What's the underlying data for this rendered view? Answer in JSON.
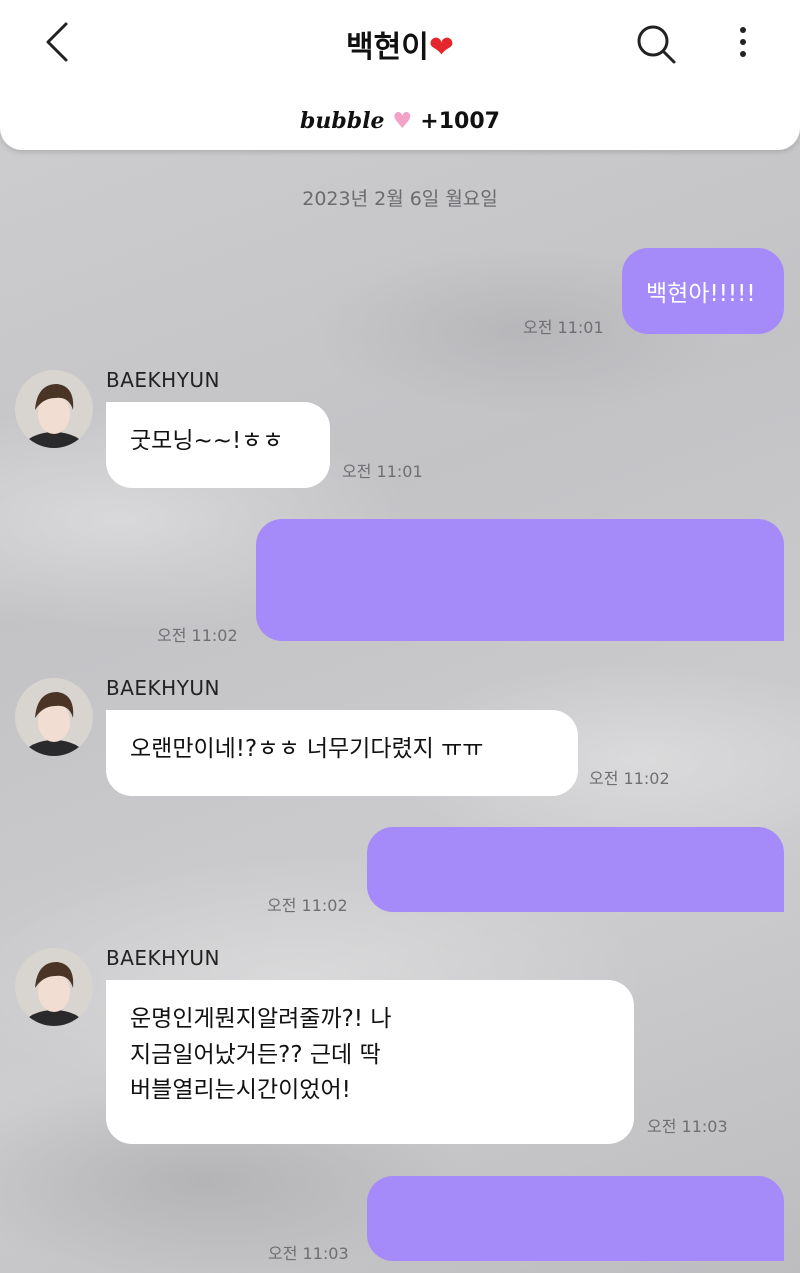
{
  "header": {
    "title": "백현이",
    "title_heart": "❤",
    "bubble_logo": "bubble",
    "bubble_count": "+1007"
  },
  "chat": {
    "date": "2023년 2월 6일 월요일",
    "sender_name": "BAEKHYUN",
    "messages": [
      {
        "from": "me",
        "text": "백현아!!!!!",
        "time": "오전 11:01"
      },
      {
        "from": "artist",
        "text": "굿모닝~~!ㅎㅎ",
        "time": "오전 11:01"
      },
      {
        "from": "me",
        "text": "",
        "time": "오전 11:02"
      },
      {
        "from": "artist",
        "text": "오랜만이네!?ㅎㅎ 너무기다렸지 ㅠㅠ",
        "time": "오전 11:02"
      },
      {
        "from": "me",
        "text": "",
        "time": "오전 11:02"
      },
      {
        "from": "artist",
        "lines": [
          "운명인게뭔지알려줄까?! 나",
          "지금일어났거든?? 근데 딱",
          "버블열리는시간이었어!"
        ],
        "time": "오전 11:03"
      },
      {
        "from": "me",
        "text": "",
        "time": "오전 11:03"
      }
    ]
  },
  "colors": {
    "outgoing_bubble": "#a58bfa",
    "incoming_bubble": "#ffffff",
    "heart": "#e5262c",
    "bubble_heart": "#f3a1c7"
  },
  "icons": [
    "back-arrow-icon",
    "search-icon",
    "more-vertical-icon",
    "pink-heart-icon"
  ]
}
